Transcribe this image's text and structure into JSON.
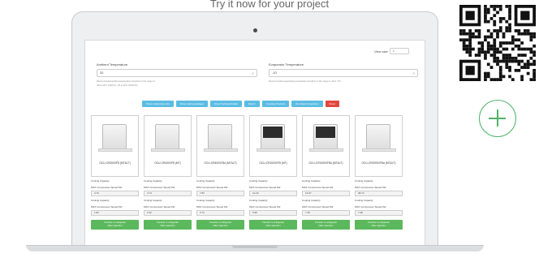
{
  "caption": "Try it now for your project",
  "screen": {
    "view_label": "View size",
    "view_value": "1",
    "ambient": {
      "label": "Ambient Temperature",
      "value": "32",
      "hint1": "Recommended ambient temperature should be in the range of",
      "hint2": "-25 to 43°C (CR/UC), -25 to 43°C (DCF/UC)"
    },
    "evaporator": {
      "label": "Evaporator Temperature",
      "value": "-10",
      "hint1": "Recommended evaporating temperature should be in the range of -45 to -5°C"
    },
    "buttons": [
      {
        "label": "Show condensing units"
      },
      {
        "label": "Show cooling packages"
      },
      {
        "label": "Show Technical Details"
      },
      {
        "label": "Rate It!"
      },
      {
        "label": "Compare Products"
      },
      {
        "label": "Download Comparison"
      },
      {
        "label": "Reset"
      }
    ],
    "cards": [
      {
        "name": "OCU-CR200VF8 (MT&LT)",
        "spec1": "Cooling Capacity",
        "spec2": "MAX Compressor Speed kW",
        "val1": "3.73",
        "val2": "1.82",
        "cta1": "Transfer to refrigerant",
        "cta2": "Filter selection",
        "dark": false
      },
      {
        "name": "OCU-CR400VF8 (MT)",
        "spec1": "Cooling Capacity",
        "spec2": "MAX Compressor Speed kW",
        "val1": "4.74",
        "val2": "2.32",
        "cta1": "Transfer to refrigerant",
        "cta2": "Filter selection",
        "dark": false
      },
      {
        "name": "OCU-CR400VF8a (MT&LT)",
        "spec1": "Cooling Capacity",
        "spec2": "MAX Compressor Speed kW",
        "val1": "7.82",
        "val2": "3.74",
        "cta1": "Transfer to refrigerant",
        "cta2": "Filter selection",
        "dark": false
      },
      {
        "name": "OCU-CR1000VF8 (MT)",
        "spec1": "Cooling Capacity",
        "spec2": "MAX Compressor Speed kW",
        "val1": "12.22",
        "val2": "5.96",
        "cta1": "Transfer to refrigerant",
        "cta2": "Filter selection",
        "dark": true
      },
      {
        "name": "OCU-CR1000VF8a (MT&LT)",
        "spec1": "Cooling Capacity",
        "spec2": "MAX Compressor Speed kW",
        "val1": "14.67",
        "val2": "7.45",
        "cta1": "Transfer to refrigerant",
        "cta2": "Filter selection",
        "dark": true
      },
      {
        "name": "OCU-CR2000VF8a (MT&LT)",
        "spec1": "Cooling Capacity",
        "spec2": "MAX Compressor Speed kW",
        "val1": "28.74",
        "val2": "7.48",
        "cta1": "Transfer to refrigerant",
        "cta2": "Filter selection",
        "dark": false
      }
    ]
  },
  "colors": {
    "accent_blue": "#5bbce4",
    "reset_red": "#e2473f",
    "cta_green": "#5cb85c",
    "plus_green": "#4fb36a"
  },
  "icons": {
    "qr": "qr-code-icon",
    "add": "plus-icon",
    "search": "search-icon"
  }
}
